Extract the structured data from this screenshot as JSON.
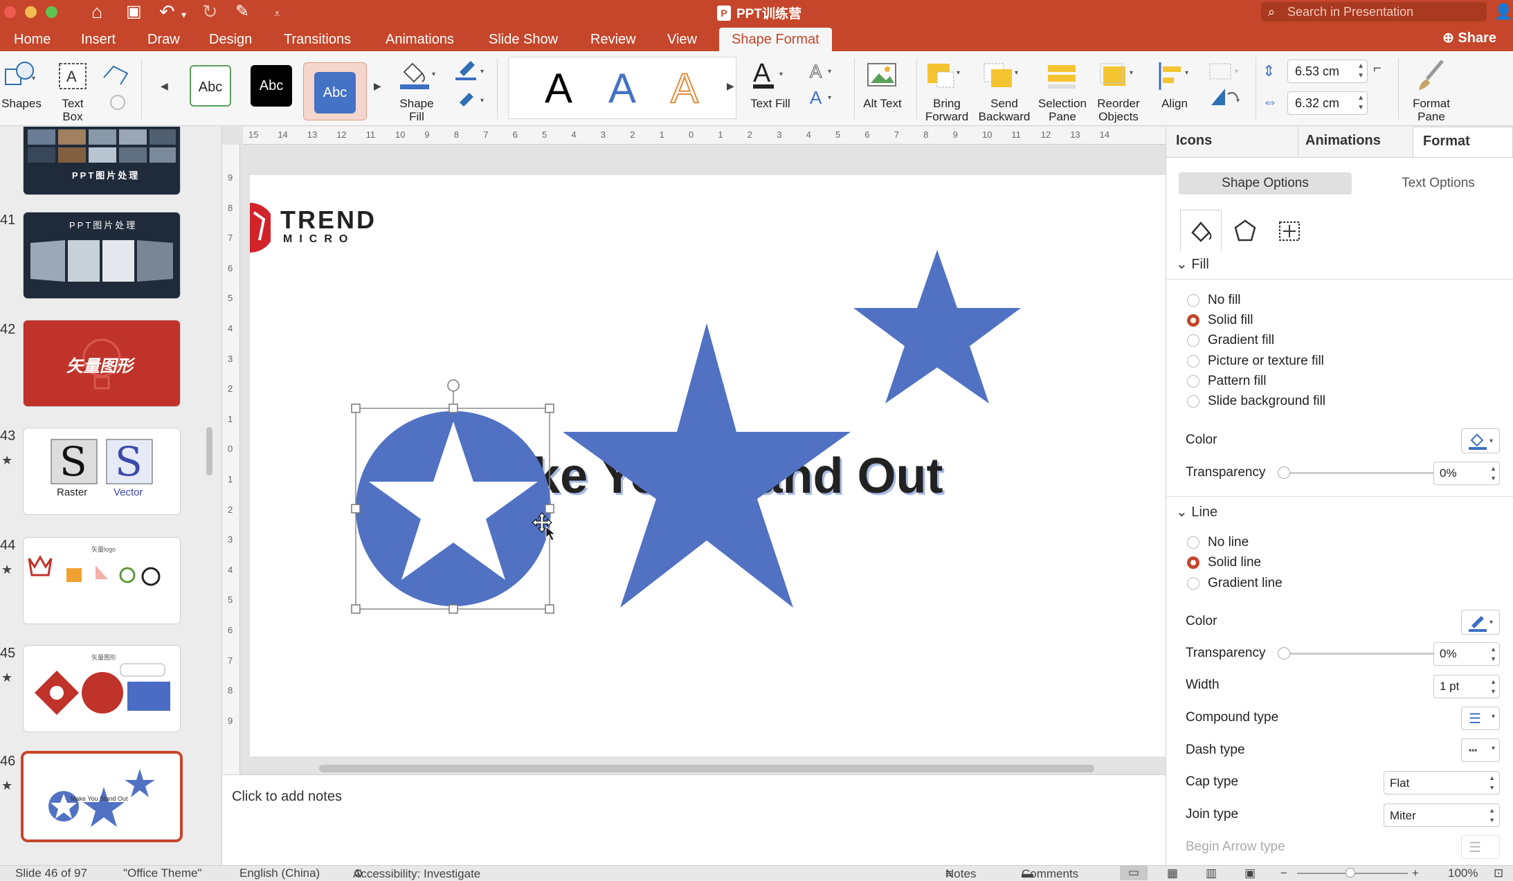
{
  "app": {
    "title": "PPT训练营",
    "search_placeholder": "Search in Presentation",
    "share_label": "Share"
  },
  "tabs": [
    "Home",
    "Insert",
    "Draw",
    "Design",
    "Transitions",
    "Animations",
    "Slide Show",
    "Review",
    "View",
    "Shape Format"
  ],
  "ribbon": {
    "shapes": "Shapes",
    "text_box": "Text Box",
    "style_sample": "Abc",
    "shape_fill": "Shape Fill",
    "wordart_letter": "A",
    "text_fill": "Text Fill",
    "alt_text": "Alt Text",
    "bring_forward": "Bring Forward",
    "send_backward": "Send Backward",
    "selection_pane": "Selection Pane",
    "reorder_objects": "Reorder Objects",
    "align": "Align",
    "height": "6.53 cm",
    "width": "6.32 cm",
    "format_pane": "Format Pane"
  },
  "thumbnails": [
    {
      "num": "",
      "title": "PPT图片处理",
      "starred": false
    },
    {
      "num": "41",
      "title": "PPT图片处理",
      "starred": false
    },
    {
      "num": "42",
      "title": "矢量图形",
      "starred": false
    },
    {
      "num": "43",
      "labels": [
        "Raster",
        "Vector"
      ],
      "starred": true
    },
    {
      "num": "44",
      "title": "矢量logo",
      "starred": true
    },
    {
      "num": "45",
      "title": "矢量图形",
      "starred": true
    },
    {
      "num": "46",
      "starred": true,
      "selected": true
    }
  ],
  "slide": {
    "logo_text": "TREND",
    "logo_sub": "MICRO",
    "headline": "Make You Stand Out",
    "shape_color": "#5171c3"
  },
  "ruler": {
    "h_ticks": [
      "15",
      "14",
      "13",
      "12",
      "11",
      "10",
      "9",
      "8",
      "7",
      "6",
      "5",
      "4",
      "3",
      "2",
      "1",
      "0",
      "1",
      "2",
      "3",
      "4",
      "5",
      "6",
      "7",
      "8",
      "9",
      "10",
      "11",
      "12",
      "13",
      "14"
    ],
    "v_ticks": [
      "9",
      "8",
      "7",
      "6",
      "5",
      "4",
      "3",
      "2",
      "1",
      "0",
      "1",
      "2",
      "3",
      "4",
      "5",
      "6",
      "7",
      "8",
      "9"
    ]
  },
  "notes_placeholder": "Click to add notes",
  "pane": {
    "tabs": [
      "Icons",
      "Animations",
      "Format Sh..."
    ],
    "segments": [
      "Shape Options",
      "Text Options"
    ],
    "fill_header": "Fill",
    "fill_options": [
      "No fill",
      "Solid fill",
      "Gradient fill",
      "Picture or texture fill",
      "Pattern fill",
      "Slide background fill"
    ],
    "fill_color_label": "Color",
    "fill_transparency_label": "Transparency",
    "fill_transparency": "0%",
    "line_header": "Line",
    "line_options": [
      "No line",
      "Solid line",
      "Gradient line"
    ],
    "line_color_label": "Color",
    "line_transparency_label": "Transparency",
    "line_transparency": "0%",
    "width_label": "Width",
    "width_value": "1 pt",
    "compound_label": "Compound type",
    "dash_label": "Dash type",
    "cap_label": "Cap type",
    "cap_value": "Flat",
    "join_label": "Join type",
    "join_value": "Miter",
    "arrow_label": "Begin Arrow type"
  },
  "status": {
    "slide_info": "Slide 46 of 97",
    "theme": "\"Office Theme\"",
    "language": "English (China)",
    "accessibility": "Accessibility: Investigate",
    "notes": "Notes",
    "comments": "Comments",
    "zoom": "100%"
  },
  "colors": {
    "accent": "#c5462a",
    "shape_blue": "#5171c3"
  }
}
